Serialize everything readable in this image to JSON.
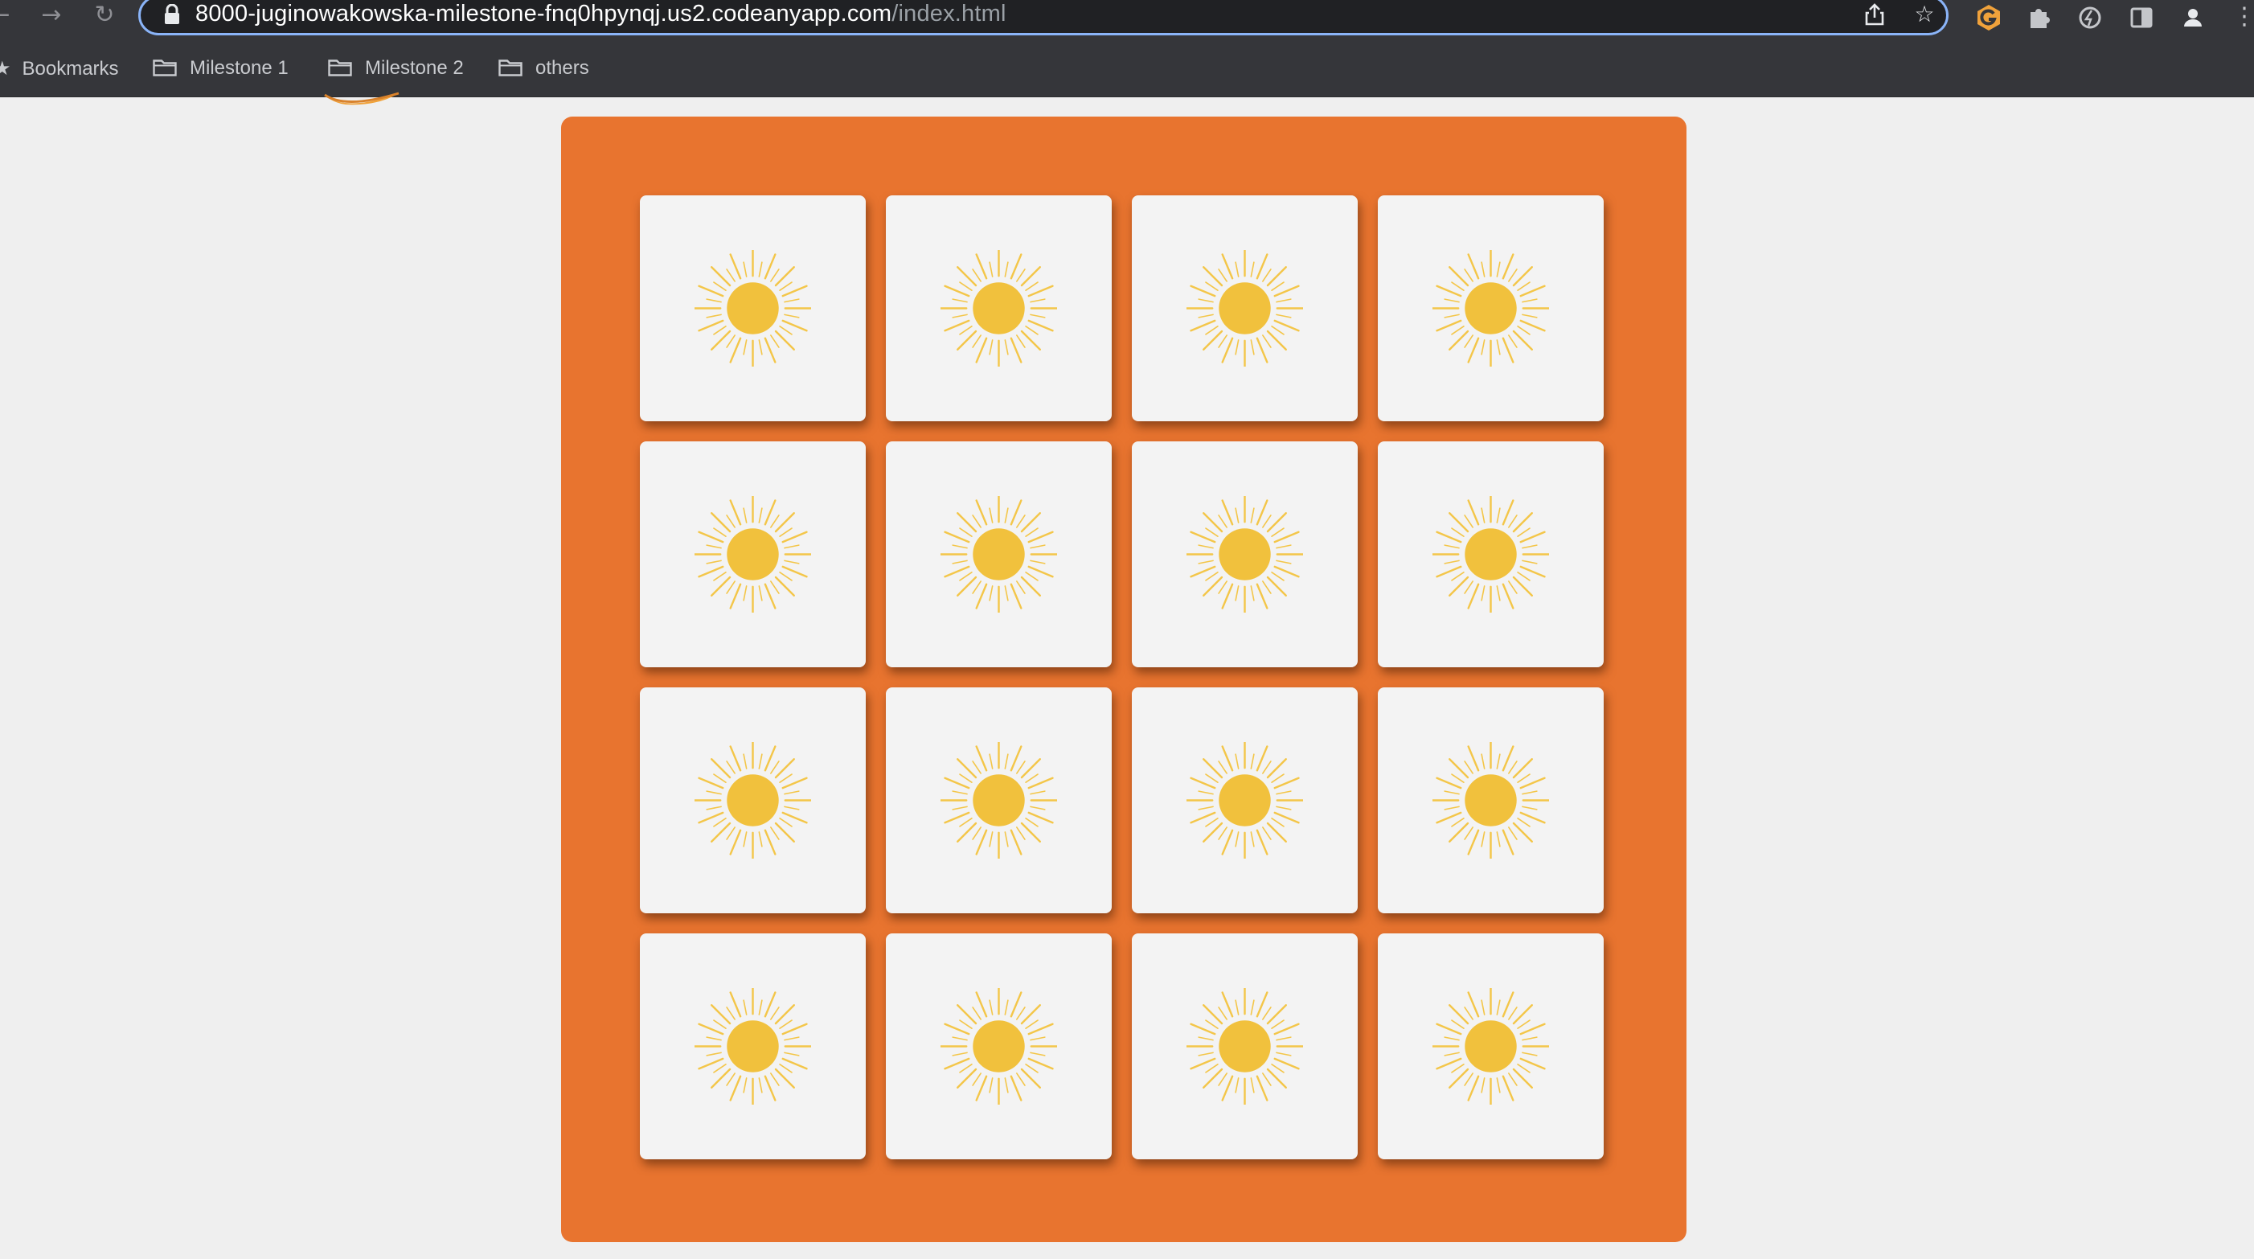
{
  "browser": {
    "url": {
      "host": "8000-juginowakowska-milestone-fnq0hpynqj.us2.codeanyapp.com",
      "path": "/index.html"
    },
    "bookmarks": [
      {
        "label": "Bookmarks",
        "icon": "star-icon"
      },
      {
        "label": "Milestone 1",
        "icon": "folder-icon"
      },
      {
        "label": "Milestone 2",
        "icon": "folder-icon"
      },
      {
        "label": "others",
        "icon": "folder-icon"
      }
    ]
  },
  "colors": {
    "board": "#e8742f",
    "card": "#f3f3f3",
    "sun": "#f1c13d",
    "sun_rays": "#f3c649"
  },
  "game": {
    "rows": 4,
    "columns": 4,
    "cards": [
      {
        "face": "down",
        "icon": "sun-icon"
      },
      {
        "face": "down",
        "icon": "sun-icon"
      },
      {
        "face": "down",
        "icon": "sun-icon"
      },
      {
        "face": "down",
        "icon": "sun-icon"
      },
      {
        "face": "down",
        "icon": "sun-icon"
      },
      {
        "face": "down",
        "icon": "sun-icon"
      },
      {
        "face": "down",
        "icon": "sun-icon"
      },
      {
        "face": "down",
        "icon": "sun-icon"
      },
      {
        "face": "down",
        "icon": "sun-icon"
      },
      {
        "face": "down",
        "icon": "sun-icon"
      },
      {
        "face": "down",
        "icon": "sun-icon"
      },
      {
        "face": "down",
        "icon": "sun-icon"
      },
      {
        "face": "down",
        "icon": "sun-icon"
      },
      {
        "face": "down",
        "icon": "sun-icon"
      },
      {
        "face": "down",
        "icon": "sun-icon"
      },
      {
        "face": "down",
        "icon": "sun-icon"
      }
    ]
  }
}
